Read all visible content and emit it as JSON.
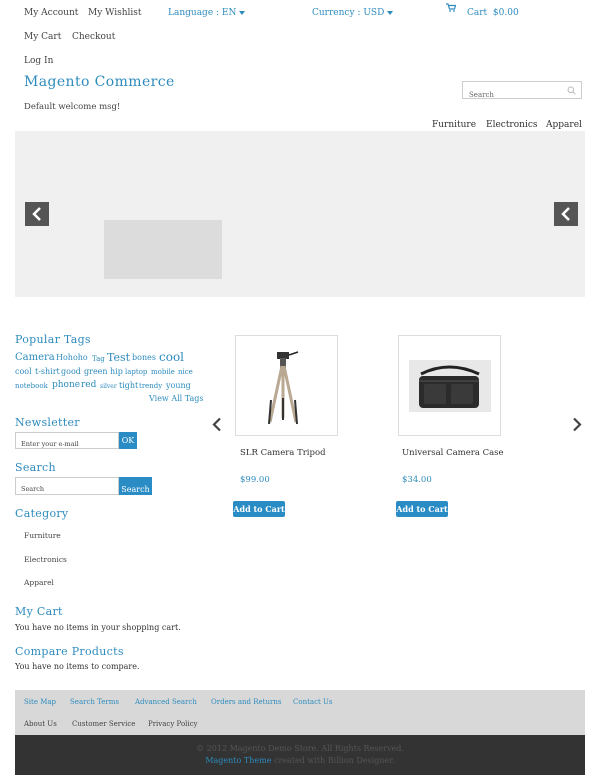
{
  "header": {
    "my_account": "My Account",
    "my_wishlist": "My Wishlist",
    "language_label": "Language",
    "language_value": ": EN",
    "currency_label": "Currency",
    "currency_value": ": USD",
    "cart_label": "Cart",
    "cart_total": "$0.00",
    "my_cart": "My Cart",
    "checkout": "Checkout",
    "log_in": "Log In",
    "logo": "Magento Commerce",
    "welcome": "Default welcome msg!",
    "search_placeholder": "Search"
  },
  "nav": [
    "Furniture",
    "Electronics",
    "Apparel"
  ],
  "sidebar": {
    "popular_tags_title": "Popular Tags",
    "tags": [
      "Camera",
      "Hohoho",
      "Tag",
      "Test",
      "bones",
      "cool",
      "cool",
      "t-shirt",
      "good",
      "green",
      "hip",
      "laptop",
      "mobile",
      "nice",
      "notebook",
      "phone",
      "red",
      "silver",
      "tight",
      "trendy",
      "young"
    ],
    "view_all_tags": "View All Tags",
    "newsletter_title": "Newsletter",
    "newsletter_placeholder": "Enter your e-mail",
    "newsletter_button": "OK",
    "search_title": "Search",
    "search_placeholder": "Search",
    "search_button": "Search",
    "category_title": "Category",
    "categories": [
      "Furniture",
      "Electronics",
      "Apparel"
    ],
    "mycart_title": "My Cart",
    "mycart_text": "You have no items in your shopping cart.",
    "compare_title": "Compare Products",
    "compare_text": "You have no items to compare."
  },
  "products": [
    {
      "name": "SLR Camera Tripod",
      "price": "$99.00",
      "button": "Add to Cart"
    },
    {
      "name": "Universal Camera Case",
      "price": "$34.00",
      "button": "Add to Cart"
    }
  ],
  "footer": {
    "links_row1": [
      "Site Map",
      "Search Terms",
      "Advanced Search",
      "Orders and Returns",
      "Contact Us"
    ],
    "links_row2": [
      "About Us",
      "Customer Service",
      "Privacy Policy"
    ],
    "copyright": "© 2012 Magento Demo Store. All Rights Reserved.",
    "theme_link": "Magento Theme",
    "theme_suffix": "created with Billion Designer."
  }
}
